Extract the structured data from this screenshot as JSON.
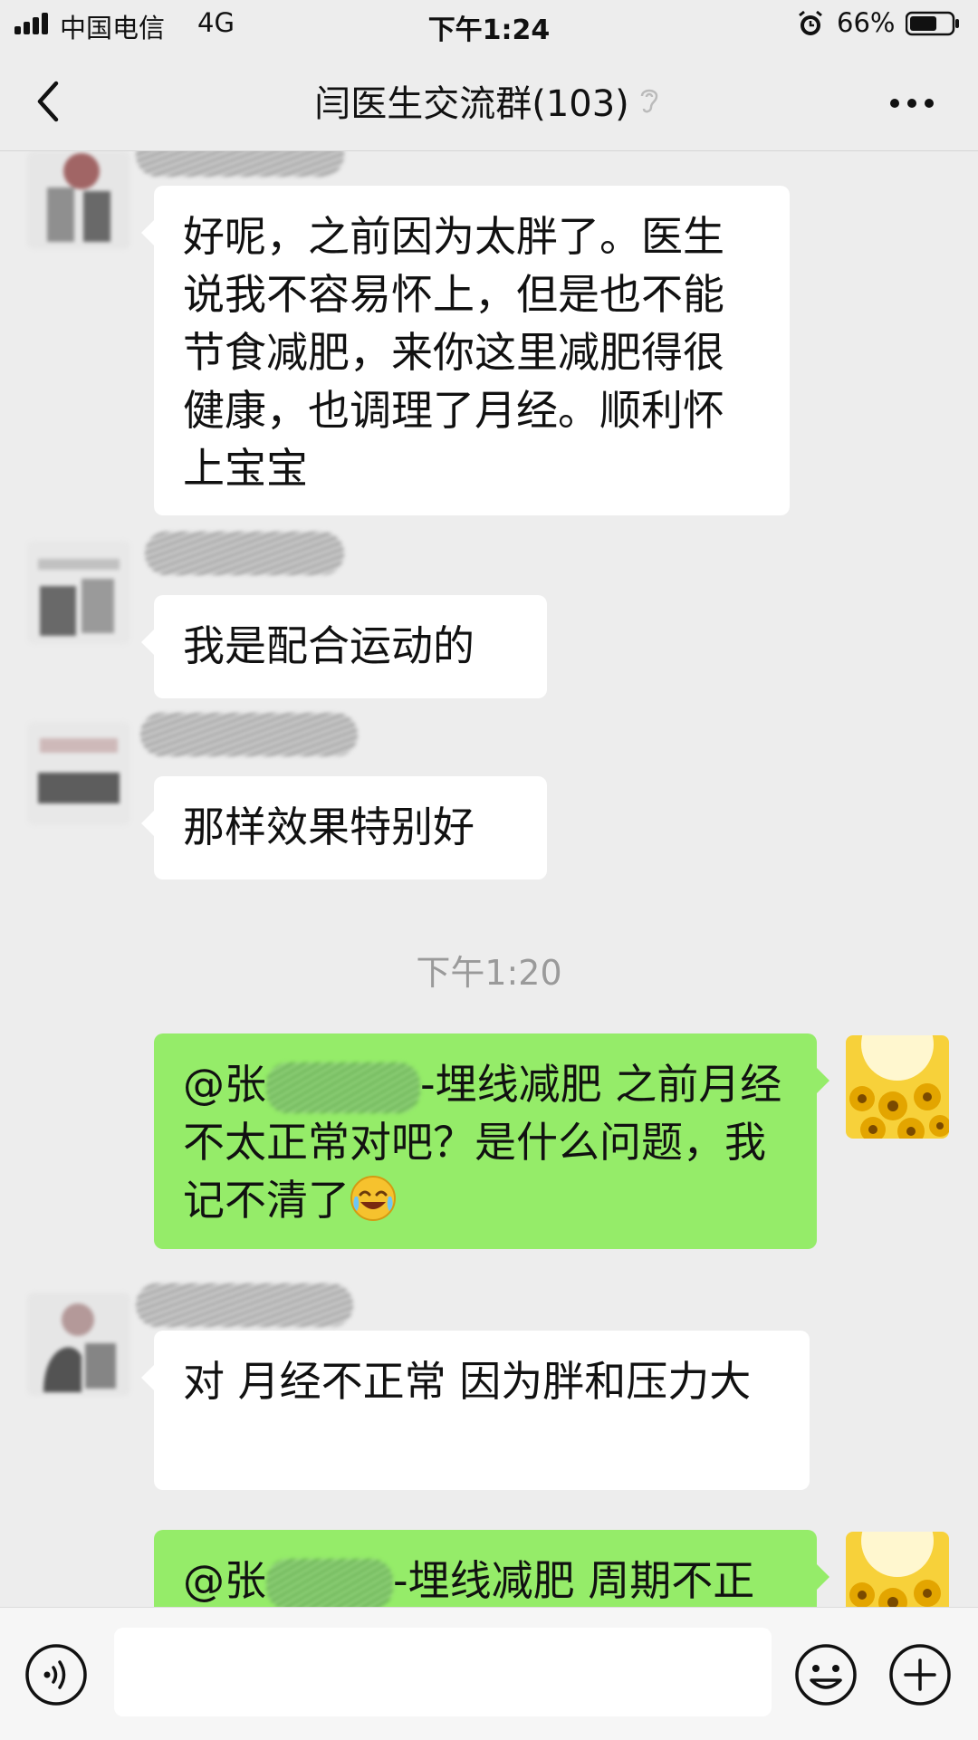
{
  "status": {
    "carrier": "中国电信",
    "network": "4G",
    "time": "下午1:24",
    "battery": "66%",
    "battery_level": 0.66
  },
  "nav": {
    "title": "闫医生交流群(103)"
  },
  "messages": [
    {
      "side": "in",
      "text": "好呢，之前因为太胖了。医生说我不容易怀上，但是也不能节食减肥，来你这里减肥得很健康，也调理了月经。顺利怀上宝宝"
    },
    {
      "side": "in",
      "sender": "瑚 张宴",
      "text": "我是配合运动的"
    },
    {
      "side": "in",
      "sender": "瑚 张",
      "text": "那样效果特别好"
    },
    {
      "type": "time",
      "text": "下午1:20"
    },
    {
      "side": "out",
      "mention_prefix": "@张",
      "mention_suffix": "-埋线减肥",
      "text": "之前月经不太正常对吧？是什么问题，我记不清了"
    },
    {
      "side": "in",
      "sender": "瑚 张",
      "text": "对 月经不正常 因为胖和压力大"
    },
    {
      "side": "out",
      "mention_prefix": "@张",
      "mention_suffix": "-埋线减肥",
      "text": "周期不正"
    }
  ],
  "input": {
    "placeholder": ""
  },
  "icons": {
    "back": "chevron-left-icon",
    "mute": "ear-icon",
    "more": "more-dots-icon",
    "voice": "voice-icon",
    "emoji": "smiley-icon",
    "plus": "plus-icon",
    "emoji_in_message": "laughing-crying-emoji"
  }
}
